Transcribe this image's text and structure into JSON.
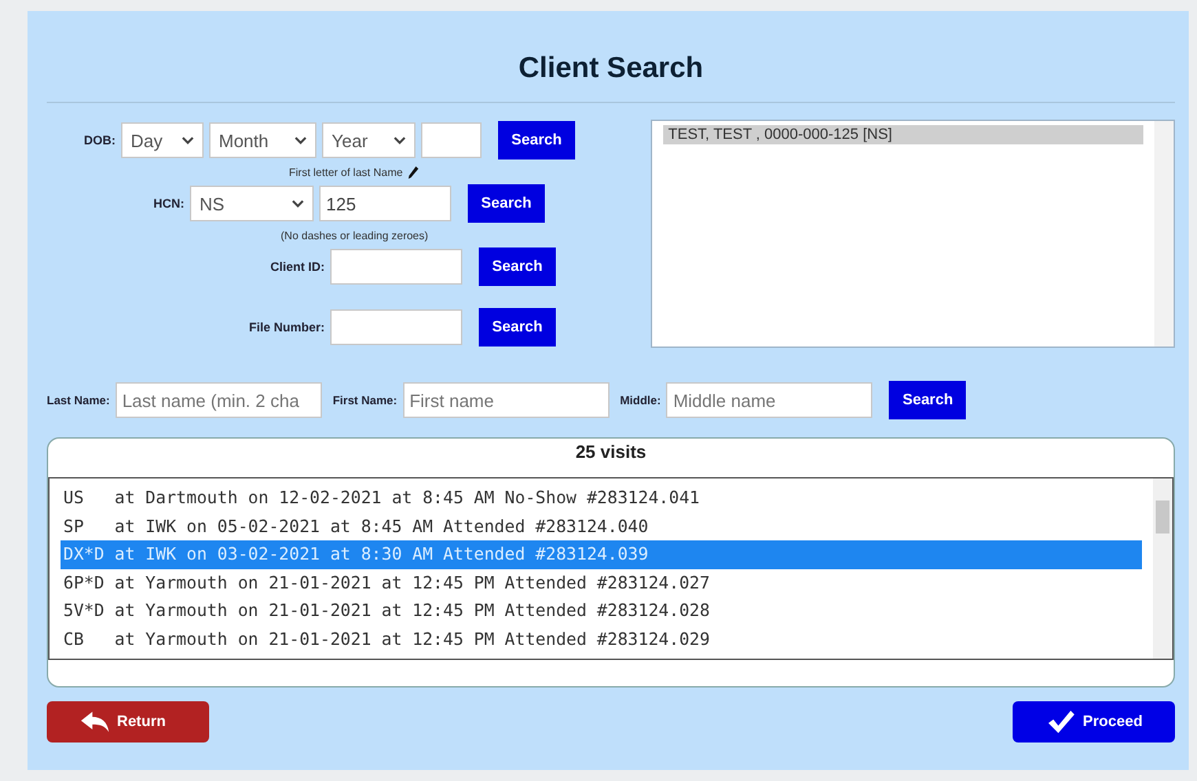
{
  "title": "Client Search",
  "dob": {
    "label": "DOB:",
    "selects": [
      "Day",
      "Month",
      "Year"
    ],
    "button": "Search",
    "hint": "First letter of last Name"
  },
  "hcn": {
    "label": "HCN:",
    "province": "NS",
    "value": "125",
    "button": "Search",
    "hint": "(No dashes or leading zeroes)"
  },
  "client_id": {
    "label": "Client ID:",
    "button": "Search"
  },
  "file_number": {
    "label": "File Number:",
    "button": "Search"
  },
  "results": [
    {
      "text": "TEST, TEST , 0000-000-125 [NS]",
      "selected": true
    }
  ],
  "name_search": {
    "fields": [
      {
        "label": "Last Name:",
        "placeholder": "Last name (min. 2 cha"
      },
      {
        "label": "First Name:",
        "placeholder": "First name"
      },
      {
        "label": "Middle:",
        "placeholder": "Middle name"
      }
    ],
    "button": "Search"
  },
  "visits": {
    "title": "25 visits",
    "rows": [
      {
        "text": "US   at Dartmouth on 12-02-2021 at 8:45 AM No-Show #283124.041",
        "selected": false
      },
      {
        "text": "SP   at IWK on 05-02-2021 at 8:45 AM Attended #283124.040",
        "selected": false
      },
      {
        "text": "DX*D at IWK on 03-02-2021 at 8:30 AM Attended #283124.039",
        "selected": true
      },
      {
        "text": "6P*D at Yarmouth on 21-01-2021 at 12:45 PM Attended #283124.027",
        "selected": false
      },
      {
        "text": "5V*D at Yarmouth on 21-01-2021 at 12:45 PM Attended #283124.028",
        "selected": false
      },
      {
        "text": "CB   at Yarmouth on 21-01-2021 at 12:45 PM Attended #283124.029",
        "selected": false
      }
    ]
  },
  "buttons": {
    "return": "Return",
    "proceed": "Proceed"
  }
}
